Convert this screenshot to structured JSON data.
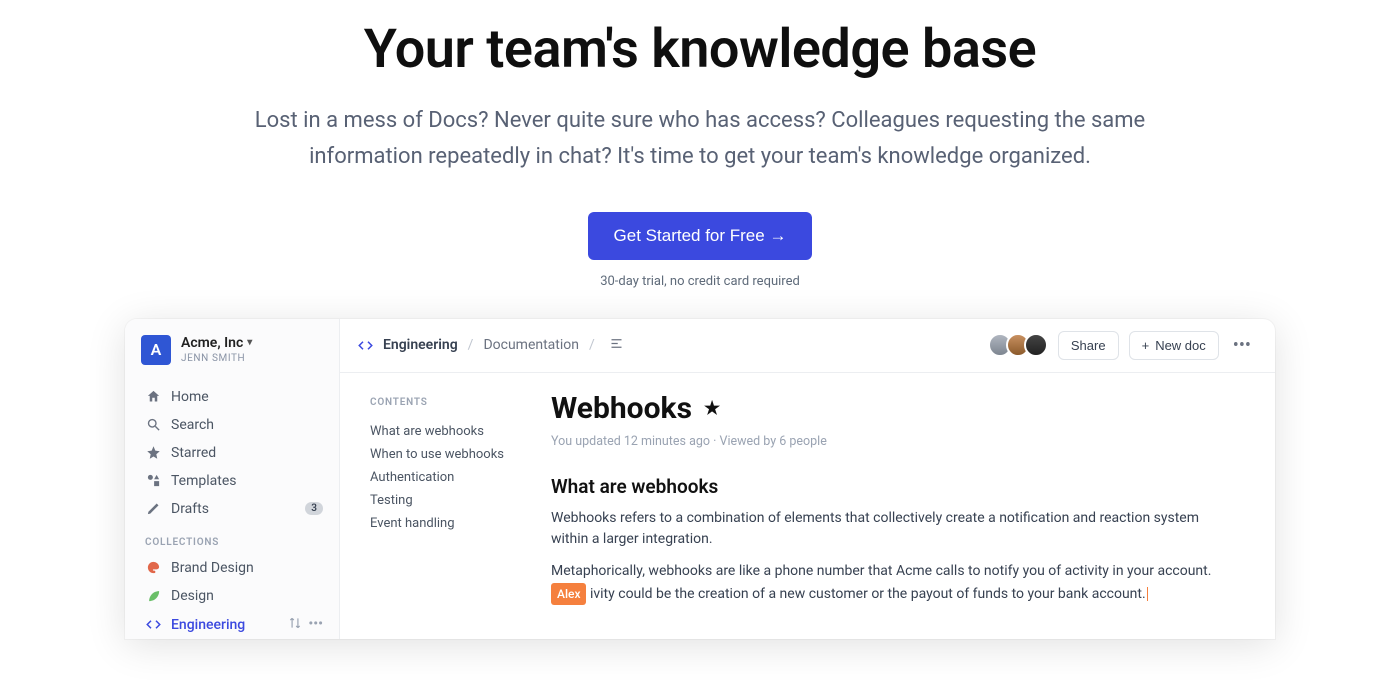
{
  "hero": {
    "title": "Your team's knowledge base",
    "subtitle": "Lost in a mess of Docs? Never quite sure who has access? Colleagues requesting the same information repeatedly in chat? It's time to get your team's knowledge organized.",
    "cta_label": "Get Started for Free →",
    "cta_note": "30-day trial, no credit card required"
  },
  "workspace": {
    "logo_letter": "A",
    "name": "Acme, Inc",
    "user": "JENN SMITH"
  },
  "nav": {
    "home": "Home",
    "search": "Search",
    "starred": "Starred",
    "templates": "Templates",
    "drafts": "Drafts",
    "drafts_count": "3"
  },
  "collections": {
    "label": "COLLECTIONS",
    "brand_design": "Brand Design",
    "design": "Design",
    "engineering": "Engineering"
  },
  "breadcrumb": {
    "root": "Engineering",
    "section": "Documentation"
  },
  "topbar": {
    "share": "Share",
    "new_doc": "New doc"
  },
  "toc": {
    "label": "CONTENTS",
    "items": {
      "what": "What are webhooks",
      "when": "When to use webhooks",
      "auth": "Authentication",
      "testing": "Testing",
      "events": "Event handling"
    }
  },
  "doc": {
    "title": "Webhooks",
    "meta": "You updated 12 minutes ago · Viewed by 6 people",
    "h2": "What are webhooks",
    "p1": "Webhooks refers to a combination of elements that collectively create a notification and reaction system within a larger integration.",
    "p2a": "Metaphorically, webhooks are like a phone number that Acme calls to notify you of activity in your account. ",
    "collab_name": "Alex",
    "p2b": "ivity could be the creation of a new customer or the payout of funds to your bank account."
  }
}
